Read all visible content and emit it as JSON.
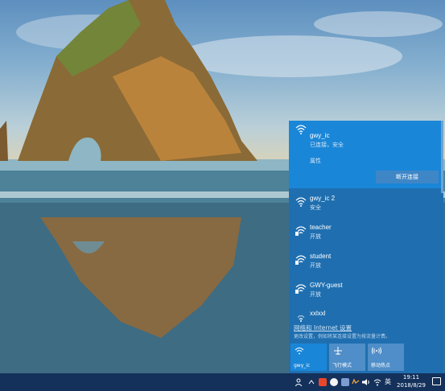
{
  "network_flyout": {
    "networks": [
      {
        "name": "gwy_ic",
        "status": "已连接，安全",
        "selected": true
      },
      {
        "name": "gwy_ic 2",
        "status": "安全"
      },
      {
        "name": "teacher",
        "status": "开放"
      },
      {
        "name": "student",
        "status": "开放"
      },
      {
        "name": "GWY-guest",
        "status": "开放"
      },
      {
        "name": "xxlxxl",
        "status": ""
      }
    ],
    "properties_label": "属性",
    "disconnect_label": "断开连接",
    "settings_link": "网络和 Internet 设置",
    "settings_desc": "更改设置，例如将某连接设置为按流量计费。",
    "quick_actions": [
      {
        "label": "gwy_ic",
        "icon": "wifi-icon",
        "active": true
      },
      {
        "label": "飞行模式",
        "icon": "airplane-icon",
        "active": false
      },
      {
        "label": "移动热点",
        "icon": "hotspot-icon",
        "active": false
      }
    ]
  },
  "taskbar": {
    "ime": "英",
    "time": "19:11",
    "date": "2018/8/29"
  },
  "colors": {
    "flyout_bg": "#1f6fb0",
    "selected_bg": "#1a86d8",
    "taskbar_bg": "#13315b"
  }
}
